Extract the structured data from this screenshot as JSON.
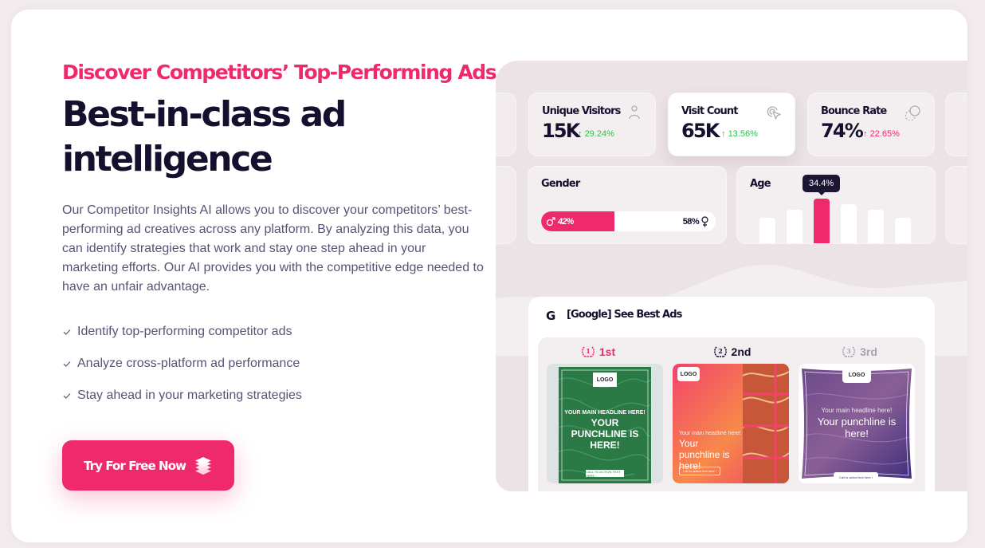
{
  "hero": {
    "eyebrow": "Discover Competitors’ Top-Performing Ads",
    "headline": "Best-in-class ad intelligence",
    "description": "Our Competitor Insights AI allows you to discover your competitors’ best-performing ad creatives across any platform. By analyzing this data, you can identify strategies that work and stay one step ahead in your marketing efforts. Our AI provides you with the competitive edge needed to have an unfair advantage.",
    "features": [
      {
        "icon": "check-icon",
        "label": "Identify top-performing competitor ads"
      },
      {
        "icon": "check-icon",
        "label": "Analyze cross-platform ad performance"
      },
      {
        "icon": "check-icon",
        "label": "Stay ahead in your marketing strategies"
      }
    ],
    "cta": {
      "label": "Try For Free Now",
      "icon": "layers-icon"
    }
  },
  "colors": {
    "accent": "#ee2a6d",
    "heading": "#14102e",
    "body": "#5a5276",
    "positive": "#2fbf4a",
    "panel_bg": "#ebe3e6"
  },
  "dashboard": {
    "stats": [
      {
        "label": "Unique Visitors",
        "value": "15K",
        "delta": "29.24%",
        "trend": "up",
        "trend_color": "green",
        "icon": "user-icon"
      },
      {
        "label": "Visit Count",
        "value": "65K",
        "delta": "13.56%",
        "trend": "up",
        "trend_color": "green",
        "icon": "click-cursor-icon",
        "highlighted": true
      },
      {
        "label": "Bounce Rate",
        "value": "74%",
        "delta": "22.65%",
        "trend": "up",
        "trend_color": "pink",
        "icon": "bounce-icon"
      }
    ],
    "gender": {
      "title": "Gender",
      "male_label": "42%",
      "female_label": "58%",
      "male_fraction": 0.42,
      "female_fraction": 0.58
    },
    "age": {
      "title": "Age",
      "tooltip": "34.4%",
      "highlight_index": 2,
      "relative_values": [
        0.45,
        0.58,
        0.78,
        0.68,
        0.58,
        0.45
      ]
    },
    "best_ads": {
      "title": "[Google] See Best Ads",
      "icon": "google-g-icon",
      "ranks": [
        {
          "label": "1st",
          "badge": "1",
          "state": "active"
        },
        {
          "label": "2nd",
          "badge": "2",
          "state": "default"
        },
        {
          "label": "3rd",
          "badge": "3",
          "state": "muted"
        }
      ],
      "ads": [
        {
          "logo": "LOGO",
          "headline": "YOUR MAIN HEADLINE HERE!",
          "punchline": "YOUR PUNCHLINE IS HERE!",
          "cta": "CALL TO ACTION TEXT HERE ›",
          "theme": "green"
        },
        {
          "logo": "LOGO",
          "headline": "Your main headline here!",
          "punchline": "Your punchline is here!",
          "cta": "Call to action text here ›",
          "theme": "coral"
        },
        {
          "logo": "LOGO",
          "headline": "Your main headline here!",
          "punchline": "Your punchline is here!",
          "cta": "Call to action text here ›",
          "theme": "purple"
        }
      ]
    }
  }
}
